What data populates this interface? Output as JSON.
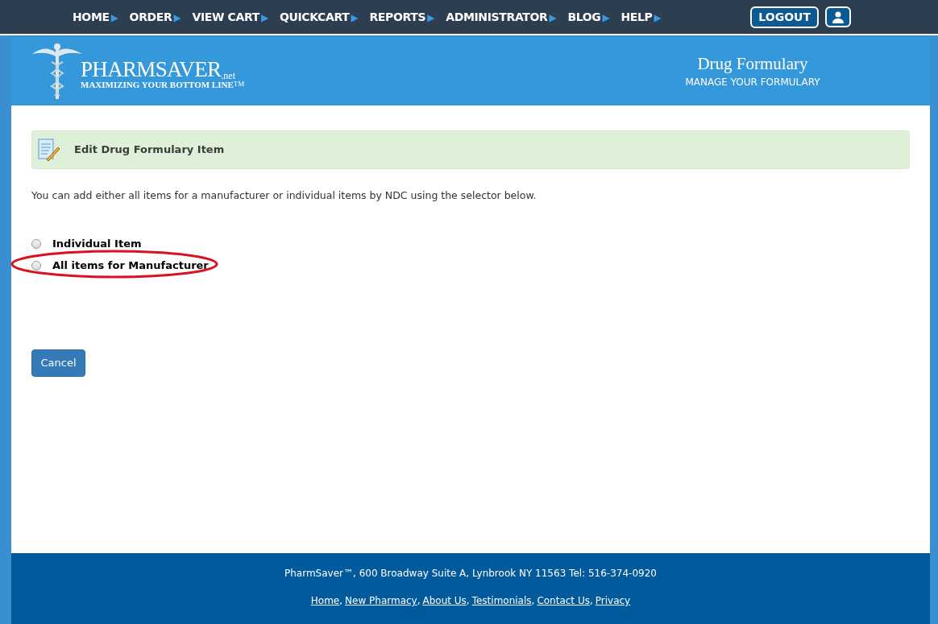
{
  "nav": {
    "items": [
      {
        "label": "HOME",
        "arrow": "▶"
      },
      {
        "label": "ORDER",
        "arrow": "▶"
      },
      {
        "label": "VIEW CART",
        "arrow": "▶"
      },
      {
        "label": "QUICKCART",
        "arrow": "▶"
      },
      {
        "label": "REPORTS",
        "arrow": "▶"
      },
      {
        "label": "ADMINISTRATOR",
        "arrow": "▶"
      },
      {
        "label": "BLOG",
        "arrow": "▶"
      },
      {
        "label": "HELP",
        "arrow": "▶"
      }
    ],
    "logout": "LOGOUT"
  },
  "header": {
    "logo": {
      "name": "PHARMSAVER",
      "suffix": ".net",
      "tagline": "MAXIMIZING YOUR BOTTOM LINE",
      "tm": "TM"
    },
    "title": "Drug Formulary",
    "subtitle": "MANAGE YOUR FORMULARY"
  },
  "panel": {
    "title": "Edit Drug Formulary Item"
  },
  "intro": "You can add either all items for a manufacturer or individual items by NDC using the selector below.",
  "options": [
    {
      "label": "Individual Item",
      "selected": false,
      "highlighted": false
    },
    {
      "label": "All items for Manufacturer",
      "selected": false,
      "highlighted": true
    }
  ],
  "cancel": "Cancel",
  "footer": {
    "address": "PharmSaver™, 600 Broadway Suite A, Lynbrook NY 11563 Tel: 516-374-0920",
    "links": [
      {
        "label": "Home",
        "separator": ","
      },
      {
        "label": "New Pharmacy",
        "separator": ","
      },
      {
        "label": "About Us",
        "separator": ","
      },
      {
        "label": "Testimonials",
        "separator": ","
      },
      {
        "label": "Contact Us",
        "separator": ","
      },
      {
        "label": "Privacy"
      }
    ]
  }
}
